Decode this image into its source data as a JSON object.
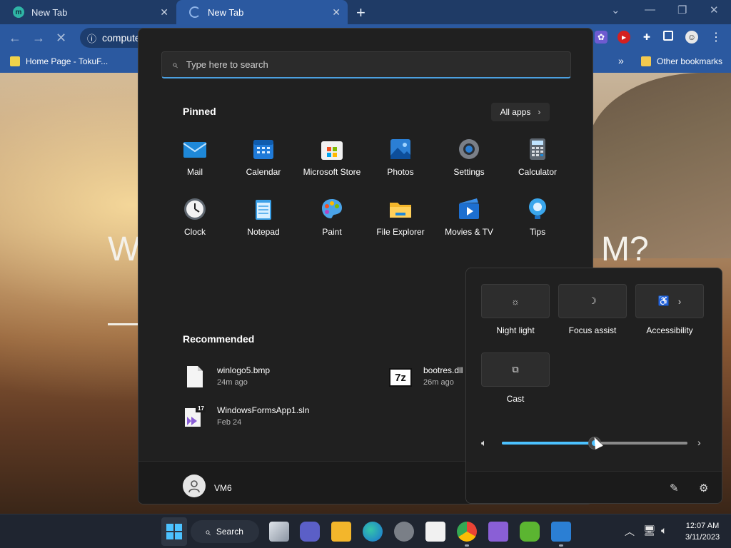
{
  "browser": {
    "tabs": [
      {
        "title": "New Tab",
        "favicon": "m"
      },
      {
        "title": "New Tab",
        "favicon": "loading-spinner"
      }
    ],
    "address": "compute",
    "bookmarks": [
      {
        "label": "Home Page - TokuF..."
      },
      {
        "label": "Other bookmarks"
      }
    ],
    "more_bookmarks": "»"
  },
  "background": {
    "text_left": "W",
    "text_right": "M?"
  },
  "start_menu": {
    "search_placeholder": "Type here to search",
    "pinned_title": "Pinned",
    "all_apps_label": "All apps",
    "pinned_apps": [
      {
        "label": "Mail",
        "icon": "mail-icon"
      },
      {
        "label": "Calendar",
        "icon": "calendar-icon"
      },
      {
        "label": "Microsoft Store",
        "icon": "store-icon"
      },
      {
        "label": "Photos",
        "icon": "photos-icon"
      },
      {
        "label": "Settings",
        "icon": "settings-gear-icon"
      },
      {
        "label": "Calculator",
        "icon": "calculator-icon"
      },
      {
        "label": "Clock",
        "icon": "clock-icon"
      },
      {
        "label": "Notepad",
        "icon": "notepad-icon"
      },
      {
        "label": "Paint",
        "icon": "paint-icon"
      },
      {
        "label": "File Explorer",
        "icon": "folder-icon"
      },
      {
        "label": "Movies & TV",
        "icon": "movies-icon"
      },
      {
        "label": "Tips",
        "icon": "lightbulb-icon"
      }
    ],
    "recommended_title": "Recommended",
    "recommended": [
      {
        "name": "winlogo5.bmp",
        "time": "24m ago",
        "icon": "file-icon"
      },
      {
        "name": "bootres.dll",
        "time": "26m ago",
        "icon": "7zip-icon",
        "icon_text": "7z"
      },
      {
        "name": "WindowsFormsApp1.sln",
        "time": "Feb 24",
        "icon": "visual-studio-solution-icon",
        "icon_text": "17"
      }
    ],
    "user_name": "VM6"
  },
  "quick_settings": {
    "tiles": [
      {
        "label": "Night light",
        "icon": "brightness-icon"
      },
      {
        "label": "Focus assist",
        "icon": "moon-icon"
      },
      {
        "label": "Accessibility",
        "icon": "accessibility-icon"
      },
      {
        "label": "Cast",
        "icon": "cast-icon"
      }
    ],
    "volume_level": 0.5
  },
  "taskbar": {
    "search_label": "Search",
    "clock_time": "12:07 AM",
    "clock_date": "3/11/2023"
  },
  "colors": {
    "accent": "#4cc2ff",
    "browser_blue": "#2b59a0",
    "start_bg": "#202020"
  }
}
